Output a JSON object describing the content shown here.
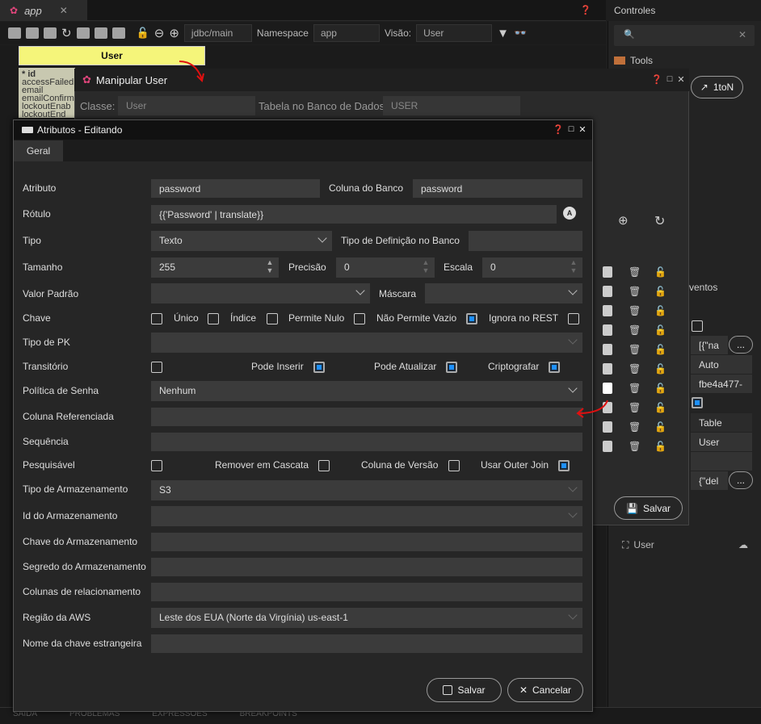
{
  "app": {
    "tab_title": "app"
  },
  "toolbar": {
    "schema": "jdbc/main",
    "namespace_label": "Namespace",
    "namespace_value": "app",
    "view_label": "Visão:",
    "view_value": "User"
  },
  "canvas": {
    "entity_name": "User",
    "entity_fields": [
      "* id",
      "accessFailed",
      "email",
      "emailConfirm",
      "lockoutEnab",
      "lockoutEnd"
    ]
  },
  "right_panel": {
    "title": "Controles",
    "tools_label": "Tools",
    "events_label": "ventos",
    "rel_button": "1toN",
    "field_na": "[{\"na",
    "field_auto": "Auto",
    "field_id": "fbe4a477-",
    "field_table": "Table",
    "field_user": "User",
    "field_del": "{\"del",
    "dots": "...",
    "tree_user": "User"
  },
  "manipular": {
    "title": "Manipular User",
    "classe_label": "Classe:",
    "classe_value": "User",
    "tabela_label": "Tabela no Banco de Dados:",
    "tabela_value": "USER",
    "save_label": "Salvar"
  },
  "bottom": {
    "items": [
      "SAÍDA",
      "PROBLEMAS",
      "EXPRESSÕES",
      "BREAKPOINTS"
    ]
  },
  "dialog": {
    "title": "Atributos - Editando",
    "tab": "Geral",
    "atributo_label": "Atributo",
    "atributo_value": "password",
    "coluna_label": "Coluna do Banco",
    "coluna_value": "password",
    "rotulo_label": "Rótulo",
    "rotulo_value": "{{'Password' | translate}}",
    "tipo_label": "Tipo",
    "tipo_value": "Texto",
    "tipodef_label": "Tipo de Definição no Banco",
    "tipodef_value": "",
    "tamanho_label": "Tamanho",
    "tamanho_value": "255",
    "precisao_label": "Precisão",
    "precisao_value": "0",
    "escala_label": "Escala",
    "escala_value": "0",
    "valorpadrao_label": "Valor Padrão",
    "mascara_label": "Máscara",
    "chave_label": "Chave",
    "unico_label": "Único",
    "indice_label": "Índice",
    "permitenulo_label": "Permite Nulo",
    "naovazio_label": "Não Permite Vazio",
    "ignorarest_label": "Ignora no REST",
    "tipopk_label": "Tipo de PK",
    "transitorio_label": "Transitório",
    "podeinserir_label": "Pode Inserir",
    "podeatualizar_label": "Pode Atualizar",
    "criptografar_label": "Criptografar",
    "politica_label": "Política de Senha",
    "politica_value": "Nenhum",
    "colref_label": "Coluna Referenciada",
    "sequencia_label": "Sequência",
    "pesquisavel_label": "Pesquisável",
    "cascata_label": "Remover em Cascata",
    "versao_label": "Coluna de Versão",
    "outerjoin_label": "Usar Outer Join",
    "tipoarm_label": "Tipo de Armazenamento",
    "tipoarm_value": "S3",
    "idarm_label": "Id do Armazenamento",
    "chavearm_label": "Chave do Armazenamento",
    "segredoarm_label": "Segredo do Armazenamento",
    "colrel_label": "Colunas de relacionamento",
    "regiao_label": "Região da AWS",
    "regiao_value": "Leste dos EUA (Norte da Virgínia) us-east-1",
    "nomechave_label": "Nome da chave estrangeira",
    "save_label": "Salvar",
    "cancel_label": "Cancelar"
  }
}
